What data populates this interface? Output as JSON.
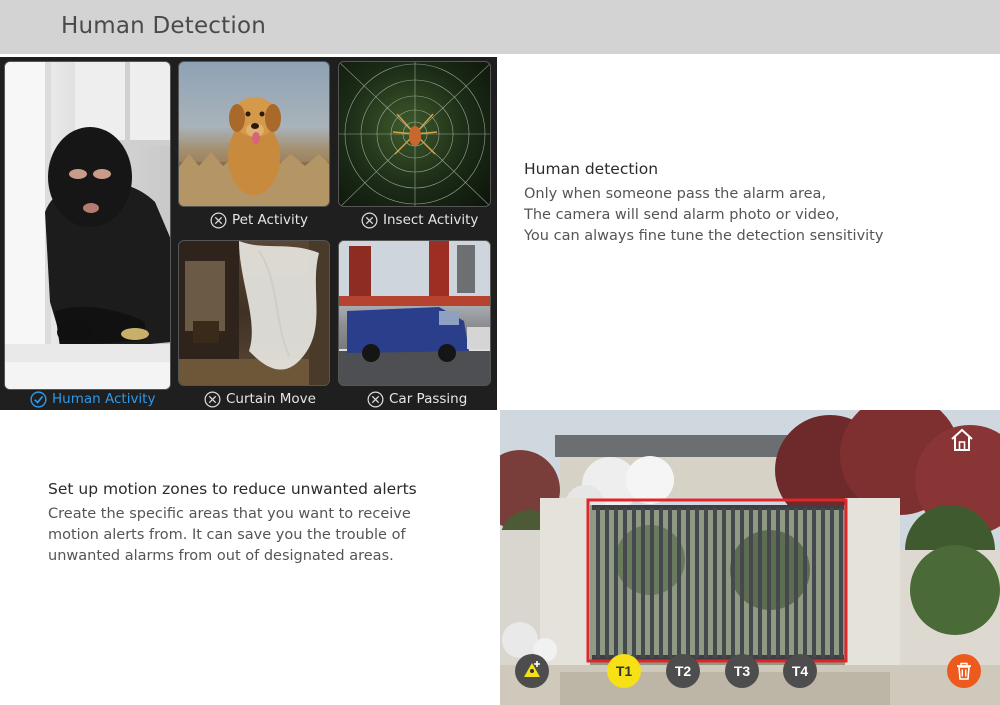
{
  "header": {
    "title": "Human Detection"
  },
  "grid": {
    "captions": [
      {
        "label": "Pet Activity",
        "state": "excluded"
      },
      {
        "label": "Insect Activity",
        "state": "excluded"
      },
      {
        "label": "Human Activity",
        "state": "selected"
      },
      {
        "label": "Curtain Move",
        "state": "excluded"
      },
      {
        "label": "Car Passing",
        "state": "excluded"
      }
    ]
  },
  "human_detection": {
    "heading": "Human detection",
    "line1": "Only when someone pass the alarm area,",
    "line2": "The camera will send alarm photo or video,",
    "line3": "You can always fine tune the detection sensitivity"
  },
  "motion_zones": {
    "heading": "Set up motion zones to reduce unwanted alerts",
    "line1": "Create the specific areas that you want to receive",
    "line2": "motion alerts from. It can save you the trouble of",
    "line3": "unwanted alarms from out of designated areas."
  },
  "zone_ui": {
    "buttons": [
      {
        "label": "T1",
        "active": true
      },
      {
        "label": "T2",
        "active": false
      },
      {
        "label": "T3",
        "active": false
      },
      {
        "label": "T4",
        "active": false
      }
    ],
    "home_icon": "home-icon",
    "add_zone_icon": "add-zone-icon",
    "delete_icon": "trash-icon",
    "zone_color": "#e0262a",
    "active_color": "#f5e116",
    "inactive_color": "#4d4d4d",
    "delete_color": "#ec5a1d"
  },
  "colors": {
    "selected": "#2e98e8",
    "header_bg": "#d3d3d3"
  }
}
